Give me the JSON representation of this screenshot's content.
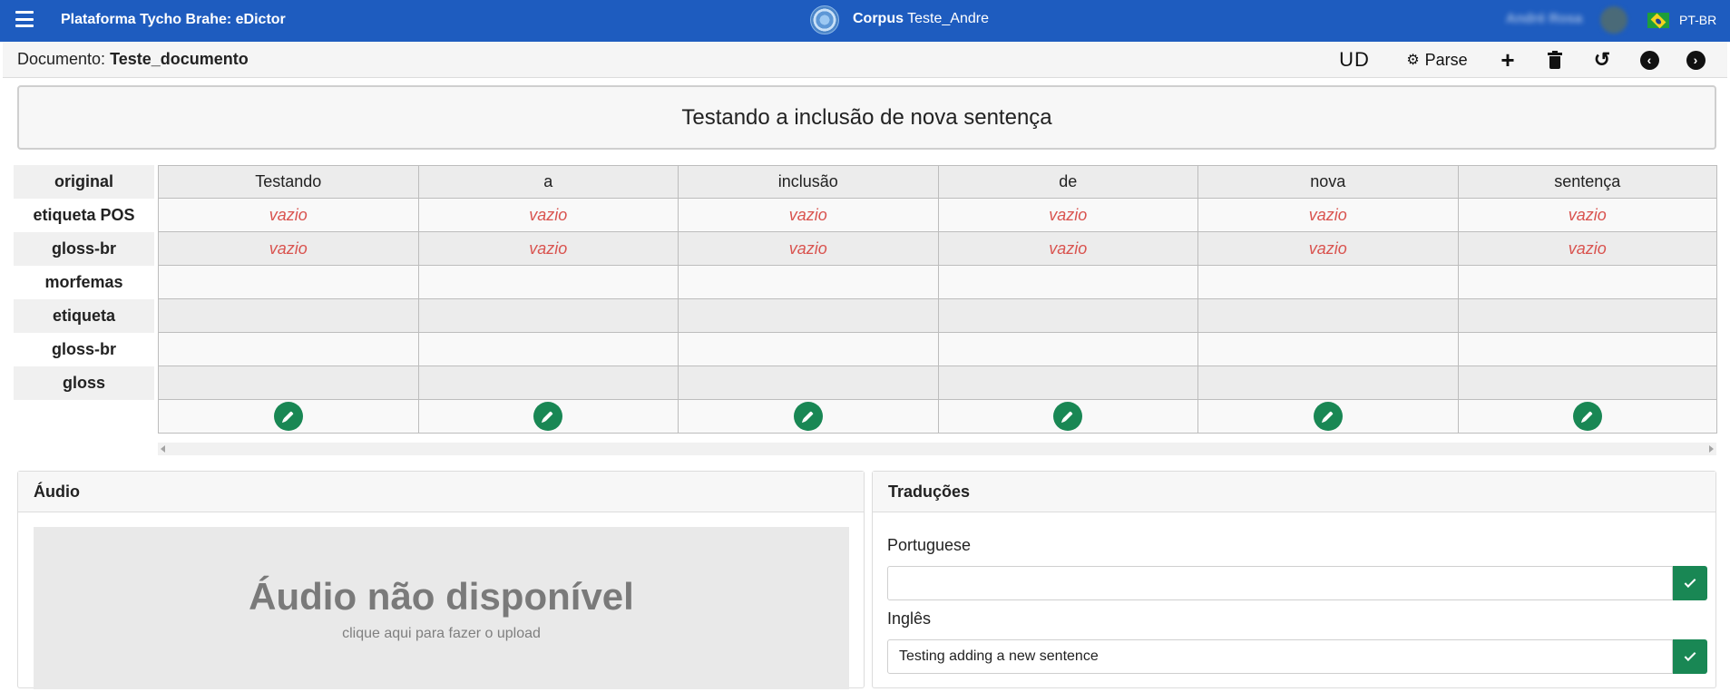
{
  "header": {
    "app_title": "Plataforma Tycho Brahe: eDictor",
    "corpus_prefix": "Corpus",
    "corpus_name": "Teste_Andre",
    "user_name": "André Rosa",
    "language": "PT-BR"
  },
  "document": {
    "label": "Documento:",
    "name": "Teste_documento"
  },
  "toolbar": {
    "ud_label": "UD",
    "parse_label": "Parse"
  },
  "sentence": "Testando a inclusão de nova sentença",
  "grid": {
    "rows": [
      "original",
      "etiqueta POS",
      "gloss-br",
      "morfemas",
      "etiqueta",
      "gloss-br",
      "gloss"
    ],
    "tokens": [
      "Testando",
      "a",
      "inclusão",
      "de",
      "nova",
      "sentença"
    ],
    "empty_value": "vazio"
  },
  "audio": {
    "title": "Áudio",
    "unavailable": "Áudio não disponível",
    "upload_hint": "clique aqui para fazer o upload"
  },
  "translations": {
    "title": "Traduções",
    "items": [
      {
        "language": "Portuguese",
        "value": ""
      },
      {
        "language": "Inglês",
        "value": "Testing adding a new sentence"
      }
    ]
  },
  "colors": {
    "topbar": "#1e5cbf",
    "success": "#198754",
    "empty_text": "#d9534f"
  }
}
